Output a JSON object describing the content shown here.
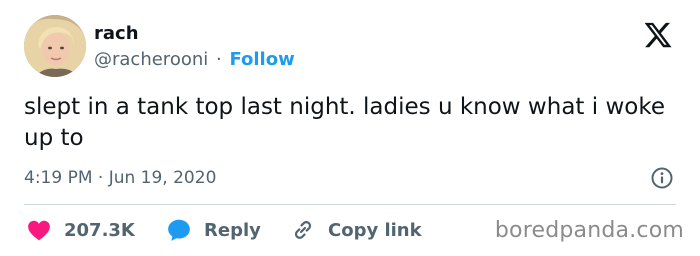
{
  "author": {
    "display_name": "rach",
    "handle": "@racherooni",
    "separator": "·",
    "follow_label": "Follow"
  },
  "tweet": {
    "text": "slept in a tank top last night. ladies u know what i woke up to",
    "timestamp": "4:19 PM · Jun 19, 2020"
  },
  "actions": {
    "like_count": "207.3K",
    "reply_label": "Reply",
    "copy_label": "Copy link"
  },
  "watermark": "boredpanda.com",
  "colors": {
    "link_blue": "#1d9bf0",
    "like_pink": "#f91880",
    "secondary_text": "#536471",
    "primary_text": "#0f1419",
    "divider": "#cfd9de"
  },
  "icons": {
    "brand": "x-logo-icon",
    "like": "heart-icon",
    "reply": "speech-bubble-icon",
    "copy": "link-icon",
    "info": "info-icon"
  }
}
